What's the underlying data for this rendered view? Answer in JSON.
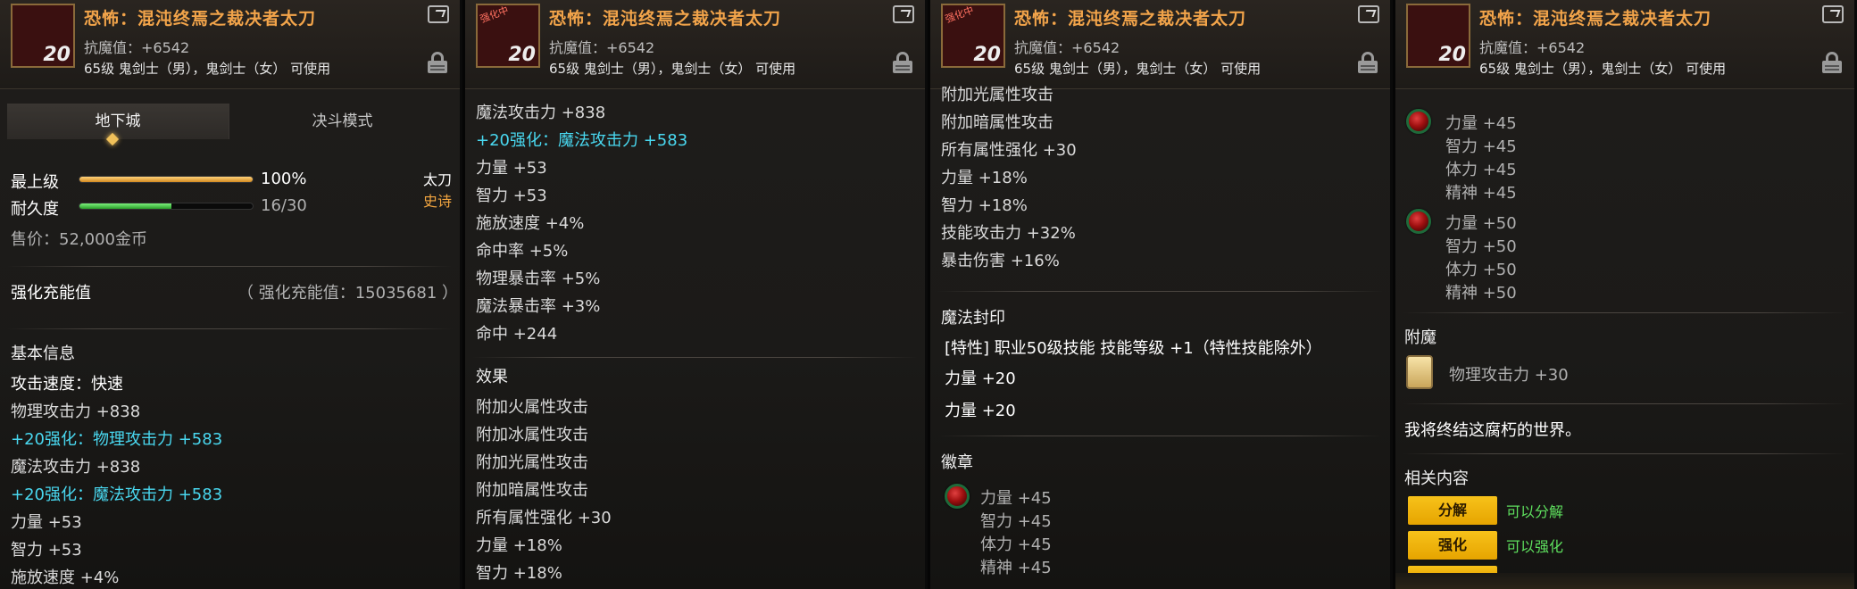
{
  "item": {
    "title": "恐怖：混沌终焉之裁决者太刀",
    "resist": "抗魔值：+6542",
    "usable": "65级 鬼剑士（男），鬼剑士（女） 可使用",
    "enhance_level": "20",
    "icon_tag": "强化中"
  },
  "panel1": {
    "tabs": [
      "地下城",
      "决斗模式"
    ],
    "grade_label": "最上级",
    "grade_value": "100%",
    "grade_fraction": 1.0,
    "durability_label": "耐久度",
    "durability_value": "16/30",
    "durability_fraction": 0.5333,
    "weapon_type": "太刀",
    "rarity": "史诗",
    "price": "售价：52,000金币",
    "charge_label": "强化充能值",
    "charge_value": "（ 强化充能值：15035681 ）",
    "basic_info_header": "基本信息",
    "attack_speed": "攻击速度：快速",
    "phys_attack": "物理攻击力 +838",
    "phys_enhance": "+20强化：物理攻击力 +583",
    "magic_attack": "魔法攻击力 +838",
    "magic_enhance": "+20强化：魔法攻击力 +583",
    "str": "力量 +53",
    "int": "智力 +53",
    "cut_line": "施放速度 +4%"
  },
  "panel2": {
    "magic_attack": "魔法攻击力 +838",
    "magic_enhance": "+20强化：魔法攻击力 +583",
    "stats": [
      "力量 +53",
      "智力 +53",
      "施放速度 +4%",
      "命中率 +5%",
      "物理暴击率 +5%",
      "魔法暴击率 +3%",
      "命中 +244"
    ],
    "effects_header": "效果",
    "effects": [
      "附加火属性攻击",
      "附加冰属性攻击",
      "附加光属性攻击",
      "附加暗属性攻击",
      "所有属性强化 +30",
      "力量 +18%",
      "智力 +18%"
    ]
  },
  "panel3": {
    "effects": [
      "附加光属性攻击",
      "附加暗属性攻击",
      "所有属性强化 +30",
      "力量 +18%",
      "智力 +18%",
      "技能攻击力 +32%",
      "暴击伤害 +16%"
    ],
    "seal_header": "魔法封印",
    "seal_lines": [
      "[特性] 职业50级技能 技能等级 +1（特性技能除外）",
      "力量 +20",
      "力量 +20"
    ],
    "emblem_header": "徽章",
    "emblem_stats": [
      "力量 +45",
      "智力 +45",
      "体力 +45",
      "精神 +45"
    ]
  },
  "panel4": {
    "emblem1": [
      "力量 +45",
      "智力 +45",
      "体力 +45",
      "精神 +45"
    ],
    "emblem2": [
      "力量 +50",
      "智力 +50",
      "体力 +50",
      "精神 +50"
    ],
    "enchant_header": "附魔",
    "enchant_stat": "物理攻击力 +30",
    "flavor": "我将终结这腐朽的世界。",
    "related_header": "相关内容",
    "actions": [
      {
        "button": "分解",
        "hint": "可以分解"
      },
      {
        "button": "强化",
        "hint": "可以强化"
      }
    ]
  }
}
